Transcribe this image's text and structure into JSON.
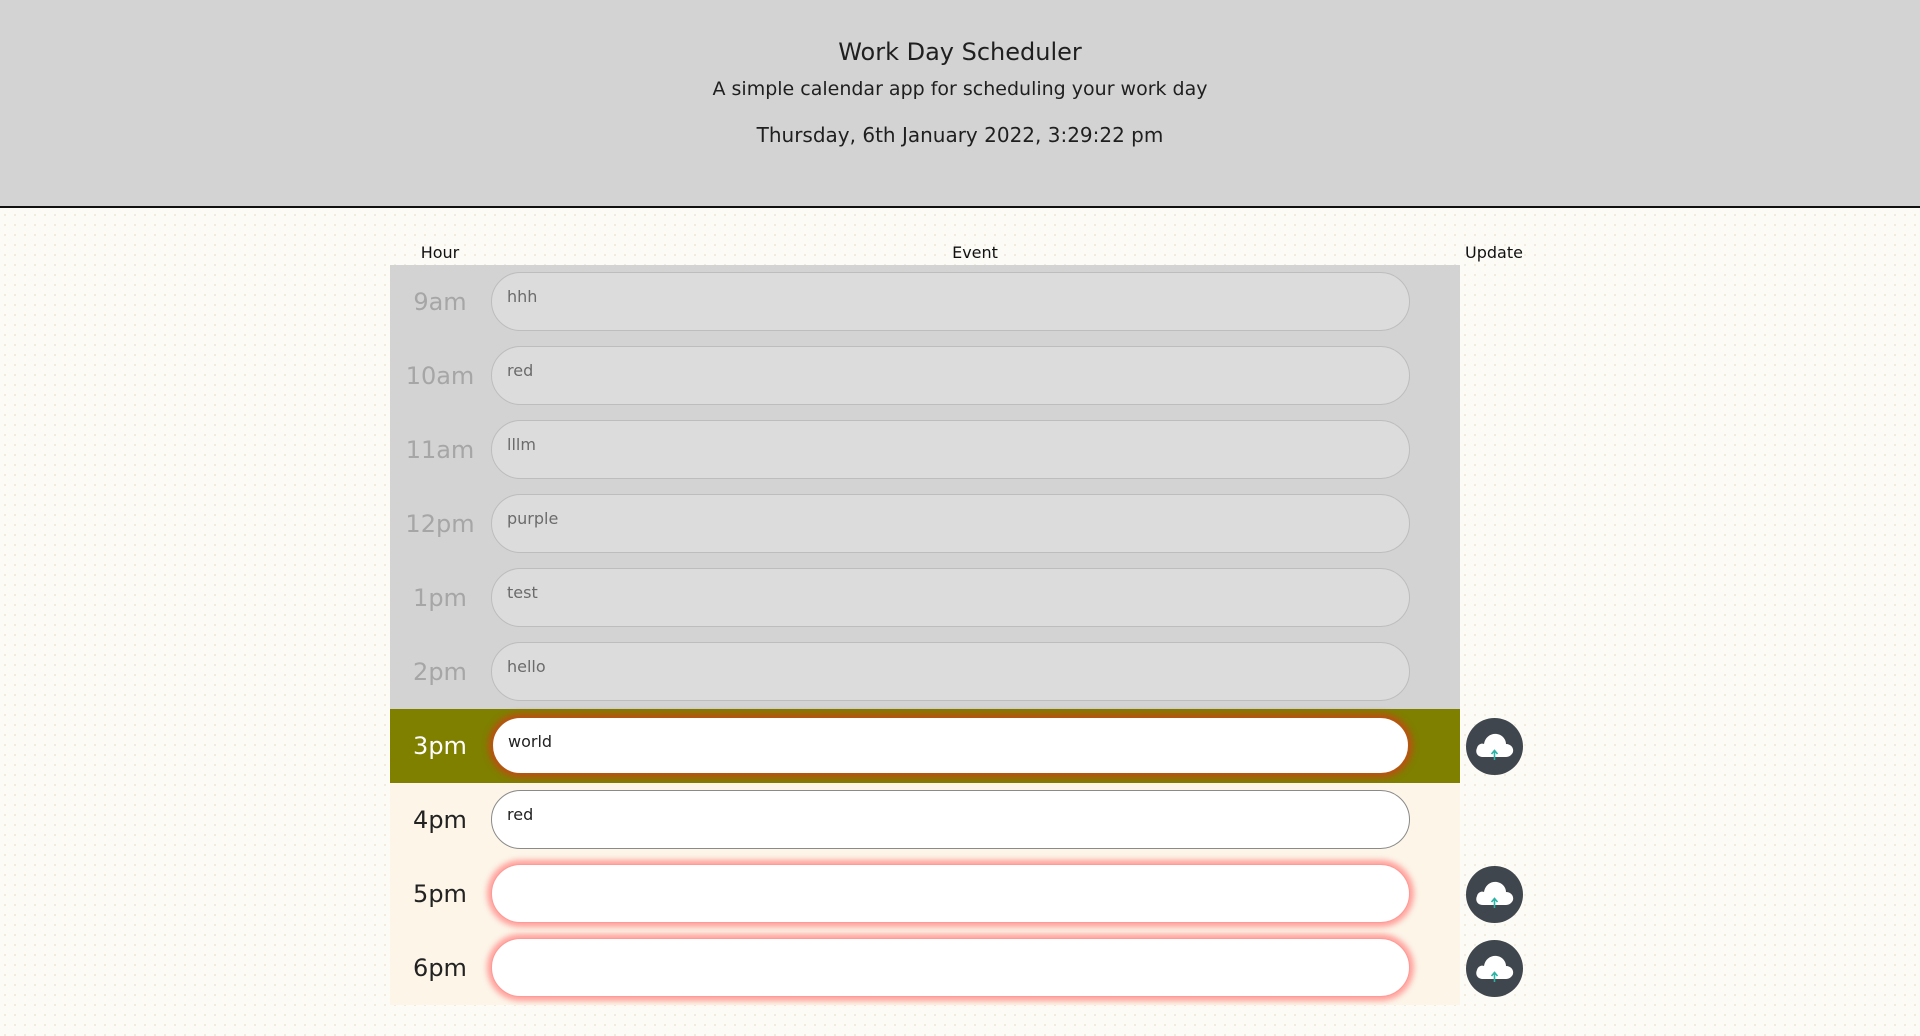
{
  "header": {
    "title": "Work Day Scheduler",
    "subtitle": "A simple calendar app for scheduling your work day",
    "current_datetime": "Thursday, 6th January 2022, 3:29:22 pm"
  },
  "columns": {
    "hour": "Hour",
    "event": "Event",
    "update": "Update"
  },
  "rows": [
    {
      "hour": "9am",
      "event": "hhh",
      "state": "past"
    },
    {
      "hour": "10am",
      "event": "red",
      "state": "past"
    },
    {
      "hour": "11am",
      "event": "lllm",
      "state": "past"
    },
    {
      "hour": "12pm",
      "event": "purple",
      "state": "past"
    },
    {
      "hour": "1pm",
      "event": "test",
      "state": "past"
    },
    {
      "hour": "2pm",
      "event": "hello",
      "state": "past"
    },
    {
      "hour": "3pm",
      "event": "world",
      "state": "present",
      "save_icon": "cloud-upload-icon"
    },
    {
      "hour": "4pm",
      "event": "red",
      "state": "future"
    },
    {
      "hour": "5pm",
      "event": "",
      "state": "future",
      "save_icon": "cloud-upload-icon"
    },
    {
      "hour": "6pm",
      "event": "",
      "state": "future",
      "save_icon": "cloud-upload-icon"
    }
  ],
  "colors": {
    "past": "#d3d3d3",
    "present": "#7f7f00",
    "future": "#fcf5e8",
    "present_glow": "#b3560f",
    "future_glow": "#ffa19c",
    "save_button": "#3f464d",
    "header_bg": "#d3d3d3"
  }
}
